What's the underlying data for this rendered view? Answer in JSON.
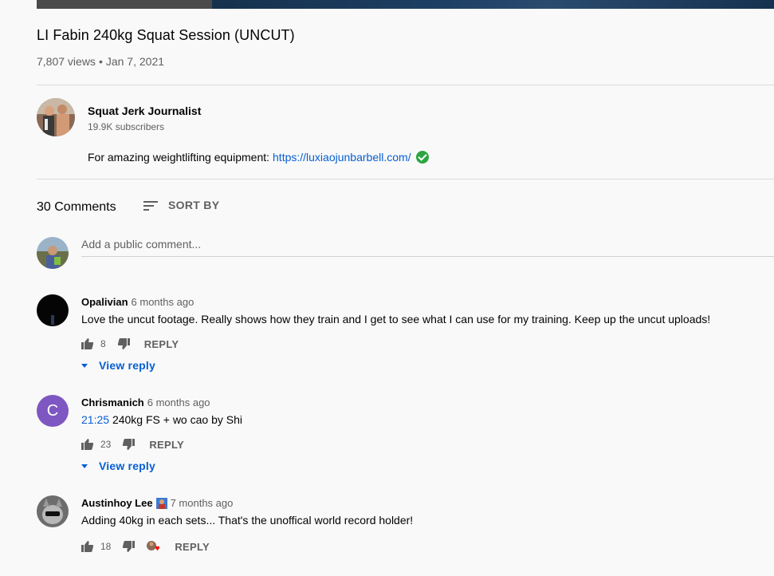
{
  "video": {
    "title": "LI Fabin 240kg Squat Session (UNCUT)",
    "views": "7,807 views",
    "separator": "•",
    "date": "Jan 7, 2021"
  },
  "channel": {
    "name": "Squat Jerk Journalist",
    "subscribers": "19.9K subscribers",
    "description_text": "For amazing weightlifting equipment:",
    "description_link": "https://luxiaojunbarbell.com/"
  },
  "comments_header": {
    "count": "30 Comments",
    "sort_label": "SORT BY"
  },
  "add_comment": {
    "placeholder": "Add a public comment..."
  },
  "comments": [
    {
      "author": "Opalivian",
      "time": "6 months ago",
      "text": "Love the uncut footage. Really shows how they train and I get to see what I can use for my training. Keep up the uncut uploads!",
      "likes": "8",
      "reply_label": "REPLY",
      "view_reply": "View reply"
    },
    {
      "author": "Chrismanich",
      "avatar_letter": "C",
      "time": "6 months ago",
      "timestamp": "21:25",
      "text": "240kg FS + wo cao by Shi",
      "likes": "23",
      "reply_label": "REPLY",
      "view_reply": "View reply"
    },
    {
      "author": "Austinhoy Lee",
      "time": "7 months ago",
      "text": "Adding 40kg in each sets... That's the unoffical world record holder!",
      "likes": "18",
      "reply_label": "REPLY"
    }
  ],
  "colors": {
    "link": "#065fd4",
    "verified": "#2ba640",
    "letter_avatar": "#7e57c2"
  }
}
